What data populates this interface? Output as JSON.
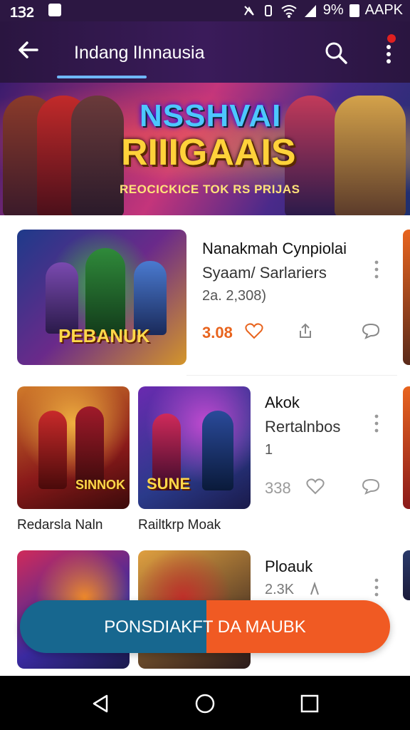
{
  "status_bar": {
    "time": "1Ɜ2",
    "battery": "9%",
    "carrier": "AAPK"
  },
  "app_bar": {
    "title": "Indang lInnausia"
  },
  "banner": {
    "title_line1": "NSSHVAI",
    "title_line2": "RIIIGAAIS",
    "subtitle": "REOCICKICE TOK RS PRIJAS"
  },
  "featured": {
    "art_label": "PEBANUK",
    "title": "Nanakmah Cynpiolai",
    "subtitle": "Syaam/ Sarlariers",
    "meta": "2a. 2,308)",
    "price": "3.08"
  },
  "row2": {
    "card1": {
      "art_label": "SINNOK",
      "caption": "Redarsla Naln"
    },
    "card2": {
      "art_label": "SUNE",
      "caption": "Railtkrp Moak"
    },
    "side": {
      "title": "Akok",
      "subtitle": "Rertalnbos",
      "count": "1",
      "price": "338"
    }
  },
  "row3": {
    "side": {
      "title": "Ploauk",
      "meta": "2.3K"
    }
  },
  "cta": {
    "label": "PONSDIAKFT DA MAUBK"
  }
}
